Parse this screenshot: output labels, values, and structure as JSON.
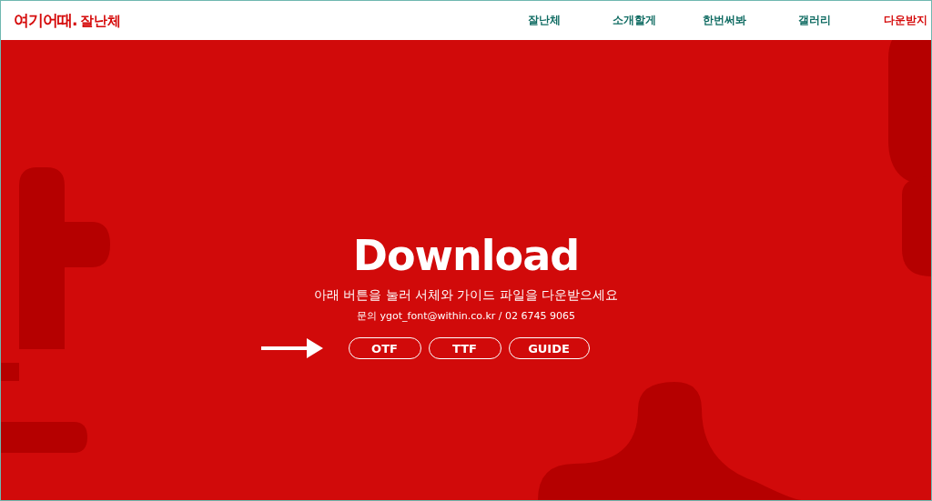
{
  "header": {
    "logo": {
      "mark": "여기어때.",
      "name": "잘난체"
    },
    "nav": [
      {
        "label": "잘난체",
        "selected": false
      },
      {
        "label": "소개할게",
        "selected": false
      },
      {
        "label": "한번써봐",
        "selected": false
      },
      {
        "label": "갤러리",
        "selected": false
      },
      {
        "label": "다운받지",
        "selected": true
      }
    ]
  },
  "hero": {
    "title": "Download",
    "subtitle": "아래 버튼을 눌러 서체와 가이드 파일을 다운받으세요",
    "contact": "문의 ygot_font@within.co.kr / 02 6745 9065",
    "buttons": [
      "OTF",
      "TTF",
      "GUIDE"
    ]
  }
}
